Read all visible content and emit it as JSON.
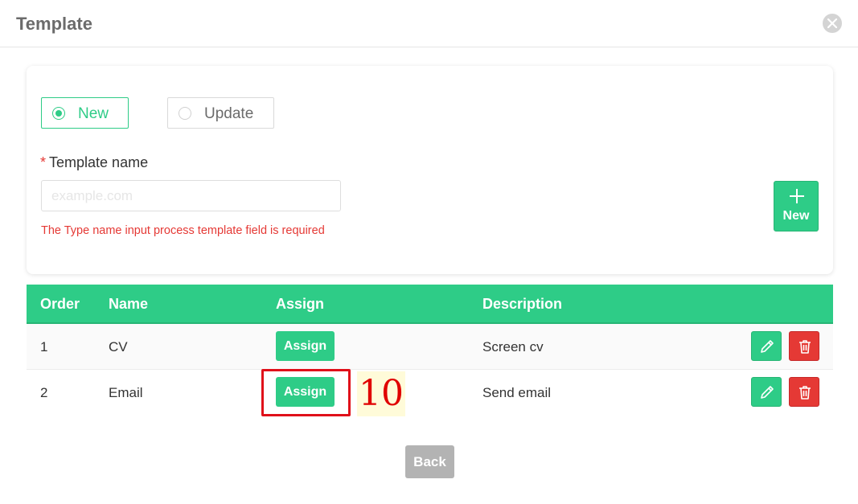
{
  "dialog": {
    "title": "Template",
    "close_icon": "close-icon"
  },
  "form": {
    "mode_options": [
      {
        "label": "New",
        "checked": true
      },
      {
        "label": "Update",
        "checked": false
      }
    ],
    "template_name_label": "Template name",
    "required_marker": "*",
    "template_name_value": "",
    "template_name_placeholder": "example.com",
    "error_text": "The Type name input process template field is required",
    "new_button_label": "New",
    "new_button_icon": "plus-icon"
  },
  "table": {
    "columns": [
      "Order",
      "Name",
      "Assign",
      "Description"
    ],
    "rows": [
      {
        "order": "1",
        "name": "CV",
        "assign_label": "Assign",
        "description": "Screen cv"
      },
      {
        "order": "2",
        "name": "Email",
        "assign_label": "Assign",
        "description": "Send email"
      }
    ]
  },
  "annotation": {
    "label": "10",
    "highlight_color": "#e0101a"
  },
  "footer": {
    "back_label": "Back"
  },
  "colors": {
    "accent": "#2ecc87",
    "danger": "#e53935",
    "muted": "#b3b3b3"
  }
}
